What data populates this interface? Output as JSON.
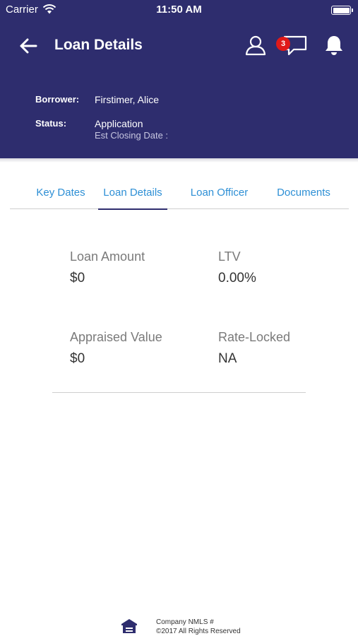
{
  "status_bar": {
    "carrier": "Carrier",
    "time": "11:50 AM"
  },
  "header": {
    "title": "Loan Details",
    "message_count": "3",
    "borrower_label": "Borrower:",
    "borrower_value": "Firstimer, Alice",
    "status_label": "Status:",
    "status_value": "Application",
    "closing_date_label": "Est Closing Date :"
  },
  "tabs": [
    {
      "label": "Key Dates",
      "active": false
    },
    {
      "label": "Loan Details",
      "active": true
    },
    {
      "label": "Loan Officer",
      "active": false
    },
    {
      "label": "Documents",
      "active": false
    }
  ],
  "loan_details": {
    "loan_amount_label": "Loan Amount",
    "loan_amount_value": "$0",
    "ltv_label": "LTV",
    "ltv_value": "0.00%",
    "appraised_value_label": "Appraised Value",
    "appraised_value_value": "$0",
    "rate_locked_label": "Rate-Locked",
    "rate_locked_value": "NA"
  },
  "footer": {
    "nmls": "Company NMLS #",
    "copyright": "©2017  All Rights Reserved"
  },
  "colors": {
    "header_bg": "#2e2d6e",
    "tab_text": "#2d8fd5",
    "badge": "#e01919"
  },
  "icons": [
    "wifi-icon",
    "battery-icon",
    "back-arrow-icon",
    "user-icon",
    "chat-icon",
    "bell-icon",
    "equal-housing-icon"
  ]
}
